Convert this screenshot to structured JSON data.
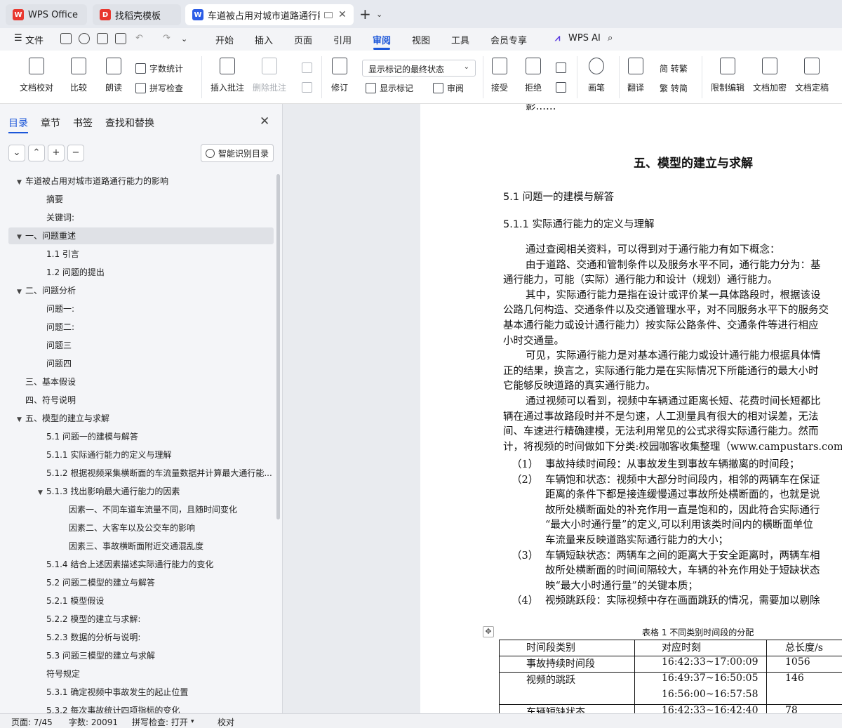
{
  "tabs": [
    {
      "label": "WPS Office",
      "logo": "W",
      "color": "#e8382f"
    },
    {
      "label": "找稻壳模板",
      "logo": "D",
      "color": "#e8382f"
    },
    {
      "label": "车道被占用对城市道路通行能力",
      "logo": "W",
      "color": "#2b5ce6"
    }
  ],
  "menu": {
    "file": "文件",
    "items": [
      "开始",
      "插入",
      "页面",
      "引用",
      "审阅",
      "视图",
      "工具",
      "会员专享"
    ],
    "active": "审阅",
    "wps_ai": "WPS AI"
  },
  "ribbon": {
    "doc_check": "文档校对",
    "compare": "比较",
    "read_aloud": "朗读",
    "word_count": "字数统计",
    "spell_check": "拼写检查",
    "insert_comment": "插入批注",
    "delete_comment": "删除批注",
    "track": "修订",
    "display_state": "显示标记的最终状态",
    "show_markup": "显示标记",
    "review": "审阅",
    "accept": "接受",
    "reject": "拒绝",
    "pen": "画笔",
    "translate": "翻译",
    "to_traditional": "简 转繁",
    "to_simplified": "繁 转简",
    "restrict_edit": "限制编辑",
    "encrypt": "文档加密",
    "finalize": "文档定稿"
  },
  "left_panel": {
    "tabs": [
      "目录",
      "章节",
      "书签",
      "查找和替换"
    ],
    "smart_toc": "智能识别目录",
    "toc": [
      {
        "label": "车道被占用对城市道路通行能力的影响",
        "level": 0,
        "arrow": "▼"
      },
      {
        "label": "摘要",
        "level": 1,
        "arrow": ""
      },
      {
        "label": "关键词:",
        "level": 1,
        "arrow": ""
      },
      {
        "label": "一、问题重述",
        "level": 0,
        "arrow": "▼",
        "selected": true
      },
      {
        "label": "1.1 引言",
        "level": 1,
        "arrow": ""
      },
      {
        "label": "1.2 问题的提出",
        "level": 1,
        "arrow": ""
      },
      {
        "label": "二、问题分析",
        "level": 0,
        "arrow": "▼"
      },
      {
        "label": "问题一:",
        "level": 1,
        "arrow": ""
      },
      {
        "label": "问题二:",
        "level": 1,
        "arrow": ""
      },
      {
        "label": "问题三",
        "level": 1,
        "arrow": ""
      },
      {
        "label": "问题四",
        "level": 1,
        "arrow": ""
      },
      {
        "label": "三、基本假设",
        "level": 0,
        "arrow": ""
      },
      {
        "label": "四、符号说明",
        "level": 0,
        "arrow": ""
      },
      {
        "label": "五、模型的建立与求解",
        "level": 0,
        "arrow": "▼"
      },
      {
        "label": "5.1 问题一的建模与解答",
        "level": 1,
        "arrow": ""
      },
      {
        "label": "5.1.1 实际通行能力的定义与理解",
        "level": 1,
        "arrow": ""
      },
      {
        "label": "5.1.2 根据视频采集横断面的车流量数据并计算最大通行能...",
        "level": 1,
        "arrow": ""
      },
      {
        "label": "5.1.3 找出影响最大通行能力的因素",
        "level": 1,
        "arrow": "▼"
      },
      {
        "label": "因素一、不同车道车流量不同，且随时间变化",
        "level": 2,
        "arrow": ""
      },
      {
        "label": "因素二、大客车以及公交车的影响",
        "level": 2,
        "arrow": ""
      },
      {
        "label": "因素三、事故横断面附近交通混乱度",
        "level": 2,
        "arrow": ""
      },
      {
        "label": "5.1.4 结合上述因素描述实际通行能力的变化",
        "level": 1,
        "arrow": ""
      },
      {
        "label": "5.2 问题二模型的建立与解答",
        "level": 1,
        "arrow": ""
      },
      {
        "label": "5.2.1 模型假设",
        "level": 1,
        "arrow": ""
      },
      {
        "label": "5.2.2 模型的建立与求解:",
        "level": 1,
        "arrow": ""
      },
      {
        "label": "5.2.3 数据的分析与说明:",
        "level": 1,
        "arrow": ""
      },
      {
        "label": "5.3 问题三模型的建立与求解",
        "level": 1,
        "arrow": ""
      },
      {
        "label": "符号规定",
        "level": 1,
        "arrow": ""
      },
      {
        "label": "5.3.1 确定视频中事故发生的起止位置",
        "level": 1,
        "arrow": ""
      },
      {
        "label": "5.3.2 每次事故统计四项指标的变化",
        "level": 1,
        "arrow": ""
      }
    ]
  },
  "doc": {
    "top_cut": "影……",
    "title": "五、模型的建立与求解",
    "h_5_1": "5.1  问题一的建模与解答",
    "h_5_1_1": "5.1.1  实际通行能力的定义与理解",
    "lines": [
      "通过查阅相关资料，可以得到对于通行能力有如下概念：",
      "由于道路、交通和管制条件以及服务水平不同，通行能力分为：基",
      "通行能力，可能（实际）通行能力和设计（规划）通行能力。",
      "其中，实际通行能力是指在设计或评价某一具体路段时，根据该设",
      "公路几何构造、交通条件以及交通管理水平，对不同服务水平下的服务交",
      "基本通行能力或设计通行能力）按实际公路条件、交通条件等进行相应",
      "小时交通量。",
      "可见，实际通行能力是对基本通行能力或设计通行能力根据具体情",
      "正的结果，换言之，实际通行能力是在实际情况下所能通行的最大小时",
      "它能够反映道路的真实通行能力。",
      "通过视频可以看到，视频中车辆通过距离长短、花费时间长短都比",
      "辆在通过事故路段时并不是匀速，人工测量具有很大的相对误差，无法",
      "间、车速进行精确建模，无法利用常见的公式求得实际通行能力。然而",
      "计，将视频的时间做如下分类:校园咖客收集整理（www.campustars.com"
    ],
    "list": [
      {
        "num": "（1）",
        "lines": [
          "事故持续时间段：从事故发生到事故车辆撤离的时间段；"
        ]
      },
      {
        "num": "（2）",
        "lines": [
          "车辆饱和状态：视频中大部分时间段内，相邻的两辆车在保证",
          "距离的条件下都是接连缓慢通过事故所处横断面的，也就是说",
          "故所处横断面处的补充作用一直是饱和的，因此符合实际通行",
          "“最大小时通行量”的定义,可以利用该类时间内的横断面单位",
          "车流量来反映道路实际通行能力的大小；"
        ]
      },
      {
        "num": "（3）",
        "lines": [
          "车辆短缺状态：两辆车之间的距离大于安全距离时，两辆车相",
          "故所处横断面的时间间隔较大，车辆的补充作用处于短缺状态",
          "映“最大小时通行量”的关键本质；"
        ]
      },
      {
        "num": "（4）",
        "lines": [
          "视频跳跃段：实际视频中存在画面跳跃的情况，需要加以剔除"
        ]
      }
    ],
    "table_caption": "表格 1  不同类别时间段的分配",
    "table_headers": [
      "时间段类别",
      "对应时刻",
      "总长度/s"
    ],
    "table_rows": [
      [
        "事故持续时间段",
        "16:42:33~17:00:09",
        "1056"
      ],
      [
        "视频的跳跃",
        "16:49:37~16:50:05",
        "146"
      ],
      [
        "",
        "16:56:00~16:57:58",
        ""
      ],
      [
        "车辆短缺状态",
        "16:42:33~16:42:40",
        "78"
      ]
    ]
  },
  "status": {
    "page": "页面: 7/45",
    "words": "字数: 20091",
    "spell": "拼写检查: 打开",
    "proof": "校对"
  }
}
